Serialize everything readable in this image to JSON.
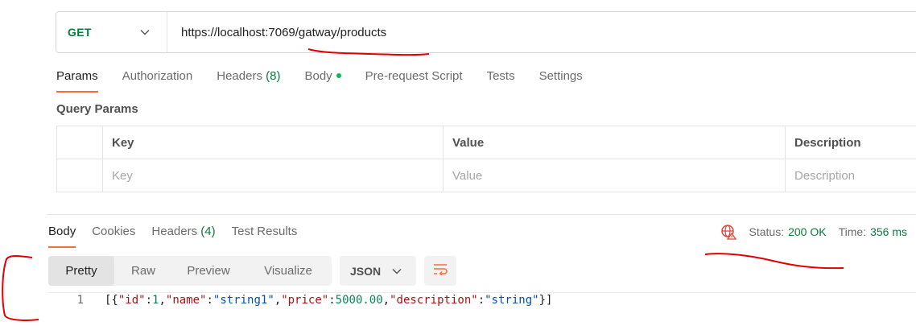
{
  "request": {
    "method": "GET",
    "url": "https://localhost:7069/gatway/products"
  },
  "request_tabs": [
    {
      "label": "Params",
      "active": true
    },
    {
      "label": "Authorization"
    },
    {
      "label": "Headers",
      "count": "(8)"
    },
    {
      "label": "Body",
      "has_dot": true
    },
    {
      "label": "Pre-request Script"
    },
    {
      "label": "Tests"
    },
    {
      "label": "Settings"
    }
  ],
  "query_params": {
    "title": "Query Params",
    "headers": [
      "Key",
      "Value",
      "Description"
    ],
    "placeholders": [
      "Key",
      "Value",
      "Description"
    ]
  },
  "response_tabs": [
    {
      "label": "Body",
      "active": true
    },
    {
      "label": "Cookies"
    },
    {
      "label": "Headers",
      "count": "(4)"
    },
    {
      "label": "Test Results"
    }
  ],
  "status": {
    "status_label": "Status:",
    "status_value": "200 OK",
    "time_label": "Time:",
    "time_value": "356 ms"
  },
  "view_modes": [
    {
      "label": "Pretty",
      "active": true
    },
    {
      "label": "Raw"
    },
    {
      "label": "Preview"
    },
    {
      "label": "Visualize"
    }
  ],
  "format": "JSON",
  "response_body": {
    "line_number": "1",
    "tokens": [
      {
        "t": "[{",
        "c": "p"
      },
      {
        "t": "\"id\"",
        "c": "k"
      },
      {
        "t": ":",
        "c": "p"
      },
      {
        "t": "1",
        "c": "n"
      },
      {
        "t": ",",
        "c": "p"
      },
      {
        "t": "\"name\"",
        "c": "k"
      },
      {
        "t": ":",
        "c": "p"
      },
      {
        "t": "\"string1\"",
        "c": "s"
      },
      {
        "t": ",",
        "c": "p"
      },
      {
        "t": "\"price\"",
        "c": "k"
      },
      {
        "t": ":",
        "c": "p"
      },
      {
        "t": "5000.00",
        "c": "n"
      },
      {
        "t": ",",
        "c": "p"
      },
      {
        "t": "\"description\"",
        "c": "k"
      },
      {
        "t": ":",
        "c": "p"
      },
      {
        "t": "\"string\"",
        "c": "s"
      },
      {
        "t": "}]",
        "c": "p"
      }
    ]
  },
  "icons": {
    "method_dropdown": "chevron-down-icon",
    "format_dropdown": "chevron-down-icon",
    "wrap": "text-wrap-icon",
    "network": "globe-warning-icon"
  },
  "colors": {
    "accent": "#ff6c37",
    "success": "#0b7a3b",
    "annotation": "#e00000"
  }
}
